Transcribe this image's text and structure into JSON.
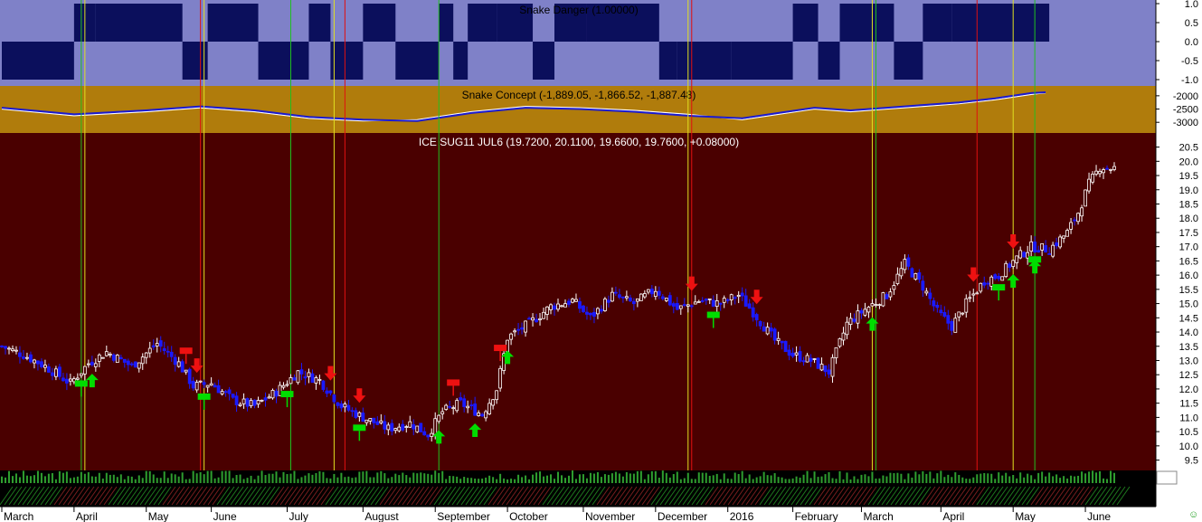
{
  "colors": {
    "panel1_bg": "#7f81c8",
    "panel1_fill": "#0b0f5c",
    "panel2_bg": "#b07c0c",
    "panel3_bg": "#4a0000",
    "axis_bg": "#ffffff",
    "up_candle": "#ffffff",
    "down_candle": "#1a1aff",
    "buy_arrow": "#00dd00",
    "sell_arrow": "#ee1111",
    "vline_green": "#20c020",
    "vline_red": "#e01010",
    "vline_yellow": "#e0e020",
    "volume": "#2f9e2f"
  },
  "chart_data": [
    {
      "type": "area",
      "title": "Snake Danger (1.00000)",
      "ylim": [
        -1,
        1
      ],
      "y_ticks": [
        "1.0",
        "0.5",
        "0.0",
        "-0.5",
        "-1.0"
      ],
      "x_index_range": [
        0,
        289
      ],
      "segments": [
        [
          0,
          19,
          -1
        ],
        [
          20,
          25,
          1
        ],
        [
          26,
          49,
          1
        ],
        [
          50,
          56,
          -1
        ],
        [
          57,
          70,
          1
        ],
        [
          71,
          84,
          -1
        ],
        [
          85,
          90,
          1
        ],
        [
          91,
          99,
          -1
        ],
        [
          100,
          108,
          1
        ],
        [
          109,
          120,
          -1
        ],
        [
          121,
          124,
          1
        ],
        [
          125,
          128,
          -1
        ],
        [
          129,
          136,
          1
        ],
        [
          137,
          146,
          1
        ],
        [
          147,
          152,
          -1
        ],
        [
          153,
          161,
          1
        ],
        [
          162,
          181,
          1
        ],
        [
          182,
          186,
          -1
        ],
        [
          187,
          201,
          -1
        ],
        [
          202,
          218,
          -1
        ],
        [
          219,
          225,
          1
        ],
        [
          226,
          231,
          -1
        ],
        [
          232,
          246,
          1
        ],
        [
          247,
          254,
          -1
        ],
        [
          255,
          262,
          1
        ],
        [
          263,
          289,
          1
        ]
      ]
    },
    {
      "type": "line",
      "title": "Snake Concept (-1,889.05, -1,866.52, -1,887.48)",
      "ylim": [
        -3300,
        -1800
      ],
      "y_ticks": [
        "-2000",
        "-2500",
        "-3000"
      ],
      "series": [
        {
          "x": [
            0,
            20,
            40,
            55,
            70,
            85,
            100,
            115,
            130,
            145,
            160,
            175,
            190,
            205,
            215,
            225,
            235,
            245,
            255,
            265,
            275,
            285,
            289
          ],
          "y": [
            -2500,
            -2750,
            -2600,
            -2450,
            -2600,
            -2850,
            -2950,
            -2900,
            -2600,
            -2400,
            -2450,
            -2550,
            -2700,
            -2900,
            -2700,
            -2500,
            -2600,
            -2500,
            -2400,
            -2300,
            -2150,
            -1950,
            -1890
          ]
        },
        {
          "x": [
            0,
            20,
            40,
            55,
            70,
            85,
            100,
            115,
            130,
            145,
            160,
            175,
            190,
            205,
            215,
            225,
            235,
            245,
            255,
            265,
            275,
            285,
            289
          ],
          "y": [
            -2450,
            -2700,
            -2550,
            -2400,
            -2550,
            -2800,
            -2900,
            -2950,
            -2650,
            -2450,
            -2500,
            -2600,
            -2750,
            -2850,
            -2650,
            -2450,
            -2550,
            -2450,
            -2350,
            -2250,
            -2100,
            -1900,
            -1867
          ]
        }
      ]
    },
    {
      "type": "candlestick",
      "title": "ICE SUG11 JUL6 (19.7200, 20.1100, 19.6600, 19.7600, +0.08000)",
      "ylim": [
        9.2,
        20.9
      ],
      "y_ticks": [
        "20.5",
        "20.0",
        "19.5",
        "19.0",
        "18.5",
        "18.0",
        "17.5",
        "17.0",
        "16.5",
        "16.0",
        "15.5",
        "15.0",
        "14.5",
        "14.0",
        "13.5",
        "13.0",
        "12.5",
        "12.0",
        "11.5",
        "11.0",
        "10.5",
        "10.0",
        "9.5"
      ],
      "x_labels": [
        {
          "label": "March",
          "x": 0
        },
        {
          "label": "April",
          "x": 20
        },
        {
          "label": "May",
          "x": 40
        },
        {
          "label": "June",
          "x": 58
        },
        {
          "label": "July",
          "x": 79
        },
        {
          "label": "August",
          "x": 100
        },
        {
          "label": "September",
          "x": 120
        },
        {
          "label": "October",
          "x": 140
        },
        {
          "label": "November",
          "x": 161
        },
        {
          "label": "December",
          "x": 181
        },
        {
          "label": "2016",
          "x": 201
        },
        {
          "label": "February",
          "x": 219
        },
        {
          "label": "March",
          "x": 238
        },
        {
          "label": "April",
          "x": 260
        },
        {
          "label": "May",
          "x": 280
        },
        {
          "label": "June",
          "x": 300
        }
      ],
      "close_points": [
        [
          0,
          13.5
        ],
        [
          6,
          13.2
        ],
        [
          12,
          12.8
        ],
        [
          19,
          12.2
        ],
        [
          24,
          12.9
        ],
        [
          29,
          13.3
        ],
        [
          36,
          12.8
        ],
        [
          43,
          13.6
        ],
        [
          49,
          12.9
        ],
        [
          53,
          12.1
        ],
        [
          58,
          12.2
        ],
        [
          64,
          11.6
        ],
        [
          70,
          11.4
        ],
        [
          76,
          11.9
        ],
        [
          82,
          12.6
        ],
        [
          88,
          12.3
        ],
        [
          94,
          11.4
        ],
        [
          100,
          11.0
        ],
        [
          107,
          10.6
        ],
        [
          113,
          10.8
        ],
        [
          118,
          10.4
        ],
        [
          122,
          11.2
        ],
        [
          127,
          11.5
        ],
        [
          133,
          11.1
        ],
        [
          137,
          12.0
        ],
        [
          140,
          13.8
        ],
        [
          146,
          14.3
        ],
        [
          152,
          14.9
        ],
        [
          158,
          15.1
        ],
        [
          163,
          14.5
        ],
        [
          169,
          15.3
        ],
        [
          175,
          15.0
        ],
        [
          181,
          15.5
        ],
        [
          187,
          14.8
        ],
        [
          193,
          15.1
        ],
        [
          199,
          15.0
        ],
        [
          204,
          15.3
        ],
        [
          208,
          14.7
        ],
        [
          214,
          13.7
        ],
        [
          219,
          13.2
        ],
        [
          224,
          13.0
        ],
        [
          229,
          12.6
        ],
        [
          234,
          14.3
        ],
        [
          239,
          14.8
        ],
        [
          245,
          15.3
        ],
        [
          250,
          16.4
        ],
        [
          255,
          15.6
        ],
        [
          259,
          14.7
        ],
        [
          263,
          14.2
        ],
        [
          267,
          15.0
        ],
        [
          272,
          15.8
        ],
        [
          276,
          16.0
        ],
        [
          281,
          16.6
        ],
        [
          285,
          17.0
        ],
        [
          290,
          16.9
        ],
        [
          295,
          17.5
        ],
        [
          298,
          18.2
        ],
        [
          301,
          19.2
        ],
        [
          304,
          19.8
        ],
        [
          308,
          19.76
        ]
      ],
      "signals": [
        {
          "x": 22,
          "type": "buy",
          "label": "EXIT"
        },
        {
          "x": 25,
          "type": "buy"
        },
        {
          "x": 51,
          "type": "sell",
          "label": "EXIT"
        },
        {
          "x": 54,
          "type": "sell"
        },
        {
          "x": 56,
          "type": "buy",
          "label": "EXIT"
        },
        {
          "x": 79,
          "type": "buy",
          "label": "EXIT"
        },
        {
          "x": 91,
          "type": "sell"
        },
        {
          "x": 99,
          "type": "sell"
        },
        {
          "x": 99,
          "type": "buy",
          "label": "EXIT"
        },
        {
          "x": 121,
          "type": "buy"
        },
        {
          "x": 125,
          "type": "sell",
          "label": "EXIT"
        },
        {
          "x": 131,
          "type": "buy"
        },
        {
          "x": 138,
          "type": "sell",
          "label": "EXIT"
        },
        {
          "x": 140,
          "type": "buy"
        },
        {
          "x": 191,
          "type": "sell"
        },
        {
          "x": 197,
          "type": "buy",
          "label": "EXIT"
        },
        {
          "x": 209,
          "type": "sell"
        },
        {
          "x": 241,
          "type": "buy"
        },
        {
          "x": 269,
          "type": "sell"
        },
        {
          "x": 276,
          "type": "buy",
          "label": "EXIT"
        },
        {
          "x": 280,
          "type": "buy"
        },
        {
          "x": 280,
          "type": "sell"
        },
        {
          "x": 286,
          "type": "buy"
        },
        {
          "x": 286,
          "type": "buy",
          "label": "EXIT"
        }
      ],
      "vertical_lines": [
        {
          "x": 22,
          "color": "green"
        },
        {
          "x": 23,
          "color": "yellow"
        },
        {
          "x": 55,
          "color": "red"
        },
        {
          "x": 56,
          "color": "yellow"
        },
        {
          "x": 80,
          "color": "green"
        },
        {
          "x": 92,
          "color": "yellow"
        },
        {
          "x": 95,
          "color": "red"
        },
        {
          "x": 121,
          "color": "green"
        },
        {
          "x": 190,
          "color": "yellow"
        },
        {
          "x": 191,
          "color": "red"
        },
        {
          "x": 241,
          "color": "yellow"
        },
        {
          "x": 242,
          "color": "green"
        },
        {
          "x": 270,
          "color": "red"
        },
        {
          "x": 280,
          "color": "yellow"
        },
        {
          "x": 286,
          "color": "green"
        }
      ]
    }
  ],
  "footer": {
    "corner_icon": "smiley-icon"
  }
}
